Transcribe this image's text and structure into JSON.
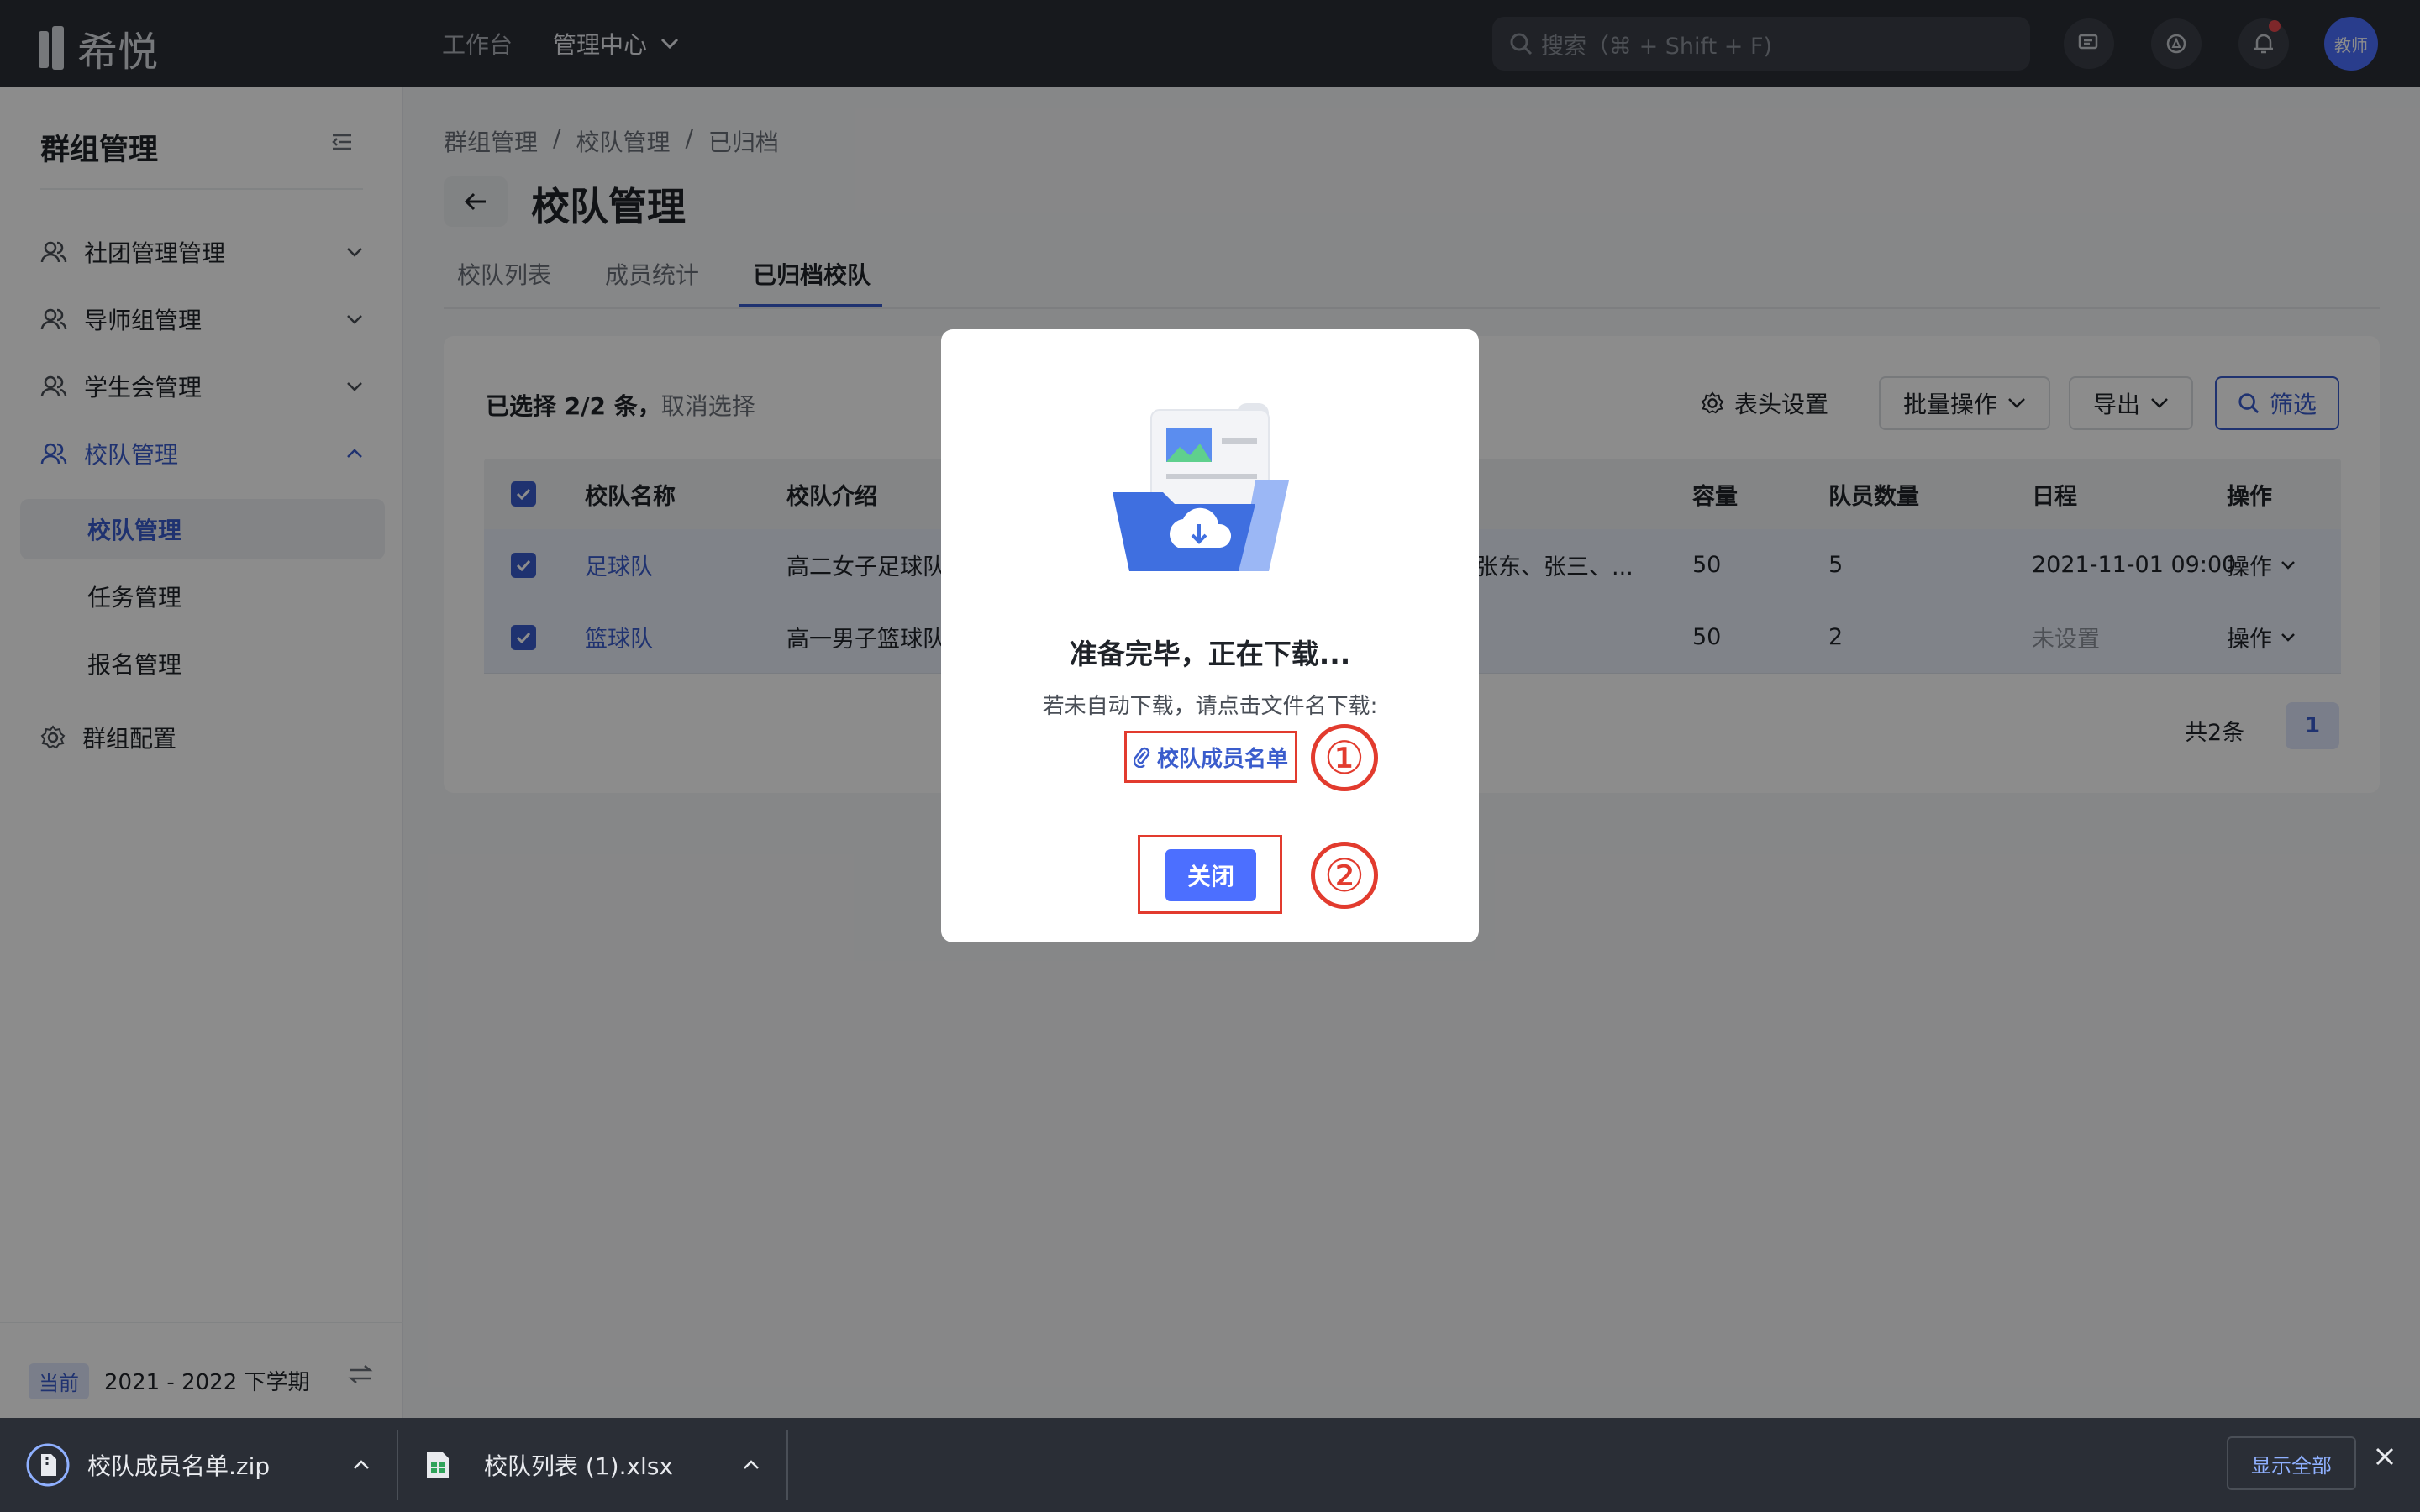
{
  "app": {
    "logo_text": "希悦"
  },
  "topnav": {
    "workbench": "工作台",
    "mgmt_center": "管理中心",
    "search_placeholder": "搜索（⌘ + Shift + F)",
    "avatar_text": "教师"
  },
  "sidebar": {
    "title": "群组管理",
    "items": [
      {
        "label": "社团管理管理"
      },
      {
        "label": "导师组管理"
      },
      {
        "label": "学生会管理"
      },
      {
        "label": "校队管理"
      }
    ],
    "subitems": [
      {
        "label": "校队管理"
      },
      {
        "label": "任务管理"
      },
      {
        "label": "报名管理"
      }
    ],
    "config_label": "群组配置",
    "term_tag": "当前",
    "term_text": "2021 - 2022 下学期"
  },
  "breadcrumb": [
    "群组管理",
    "/",
    "校队管理",
    "/",
    "已归档"
  ],
  "page": {
    "title": "校队管理"
  },
  "tabs": [
    "校队列表",
    "成员统计",
    "已归档校队"
  ],
  "toolbar": {
    "selected_text": "已选择 2/2 条，",
    "cancel_select": "取消选择",
    "header_settings": "表头设置",
    "batch_ops": "批量操作",
    "export": "导出",
    "filter": "筛选"
  },
  "table": {
    "headers": [
      "校队名称",
      "校队介绍",
      "容量",
      "队员数量",
      "日程",
      "操作"
    ],
    "rows": [
      {
        "name": "足球队",
        "intro": "高二女子足球队",
        "members_preview": "张东、张三、...",
        "capacity": "50",
        "count": "5",
        "schedule": "2021-11-01 09:00",
        "action": "操作"
      },
      {
        "name": "篮球队",
        "intro": "高一男子篮球队",
        "members_preview": "",
        "capacity": "50",
        "count": "2",
        "schedule": "未设置",
        "action": "操作"
      }
    ]
  },
  "pagination": {
    "total": "共2条",
    "current": "1"
  },
  "modal": {
    "title": "准备完毕，正在下载...",
    "desc": "若未自动下载，请点击文件名下载:",
    "file_link": "校队成员名单",
    "close": "关闭",
    "step1": "①",
    "step2": "②"
  },
  "downloads": {
    "items": [
      {
        "name": "校队成员名单.zip"
      },
      {
        "name": "校队列表 (1).xlsx"
      }
    ],
    "show_all": "显示全部"
  },
  "colors": {
    "accent": "#3a5ccc",
    "primary_button": "#4c6fff",
    "annotation": "#e23b2e"
  }
}
